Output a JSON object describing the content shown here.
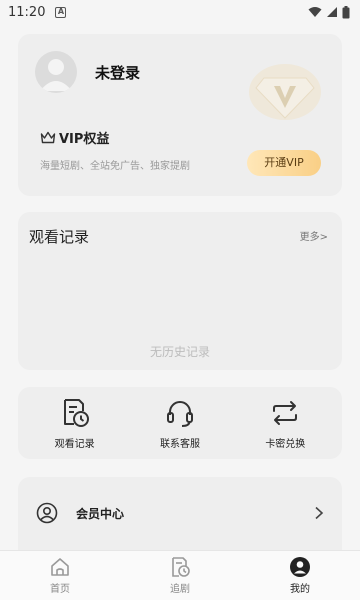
{
  "status": {
    "time": "11:20"
  },
  "profile": {
    "username": "未登录",
    "vip_title": "VIP权益",
    "vip_desc": "海量短剧、全站免广告、独家提剧",
    "vip_button": "开通VIP"
  },
  "history": {
    "title": "观看记录",
    "more": "更多>",
    "empty": "无历史记录"
  },
  "quick_actions": [
    {
      "label": "观看记录",
      "icon": "history-doc-icon"
    },
    {
      "label": "联系客服",
      "icon": "headset-icon"
    },
    {
      "label": "卡密兑换",
      "icon": "exchange-icon"
    }
  ],
  "menu": [
    {
      "label": "会员中心",
      "icon": "user-circle-icon"
    }
  ],
  "tabbar": [
    {
      "label": "首页",
      "icon": "home-icon",
      "active": false
    },
    {
      "label": "追剧",
      "icon": "follow-icon",
      "active": false
    },
    {
      "label": "我的",
      "icon": "profile-icon",
      "active": true
    }
  ],
  "colors": {
    "accent_gold": "#f9cf86",
    "card_bg": "#eeeeee",
    "page_bg": "#f5f5f5"
  }
}
